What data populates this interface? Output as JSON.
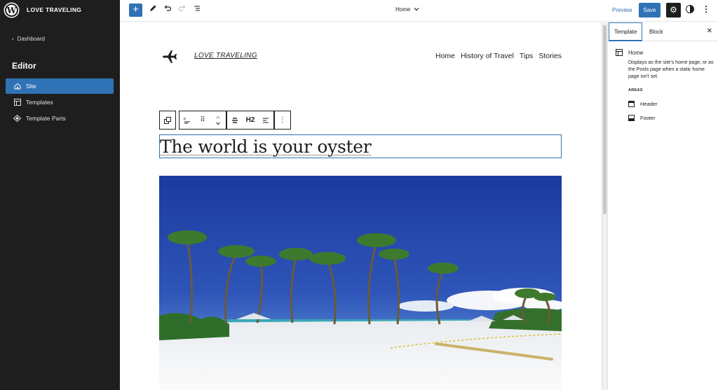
{
  "sidebar": {
    "site_title": "LOVE TRAVELING",
    "back_label": "Dashboard",
    "heading": "Editor",
    "items": [
      {
        "label": "Site",
        "icon": "home-icon",
        "active": true
      },
      {
        "label": "Templates",
        "icon": "layout-icon",
        "active": false
      },
      {
        "label": "Template Parts",
        "icon": "symbol-icon",
        "active": false
      }
    ]
  },
  "topbar": {
    "document_title": "Home",
    "preview_label": "Preview",
    "save_label": "Save"
  },
  "canvas": {
    "brand": "LOVE TRAVELING",
    "nav": [
      "Home",
      "History of Travel",
      "Tips",
      "Stories"
    ],
    "heading_level": "H2",
    "heading": "The world is your oyster"
  },
  "panel": {
    "tabs": [
      "Template",
      "Block"
    ],
    "active_tab": "Template",
    "template_name": "Home",
    "template_description": "Displays as the site's home page, or as the Posts page when a static home page isn't set.",
    "areas_label": "AREAS",
    "areas": [
      "Header",
      "Footer"
    ]
  },
  "colors": {
    "accent": "#2f72b5",
    "sidebar_bg": "#1e1e1e"
  }
}
